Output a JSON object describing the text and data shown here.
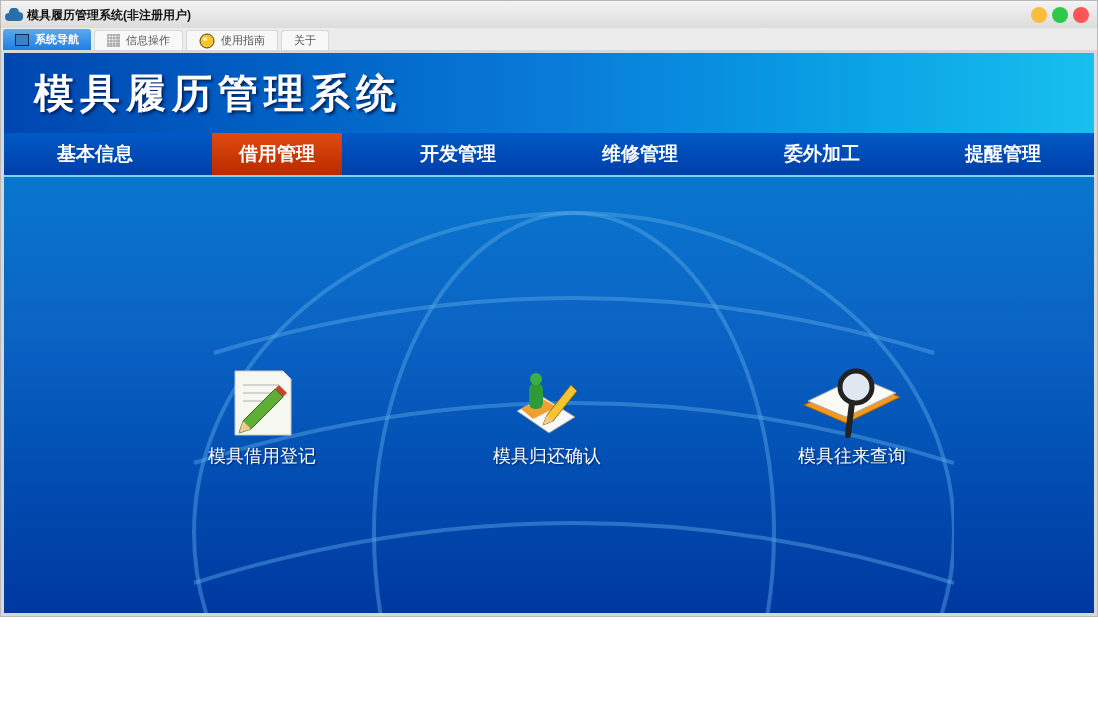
{
  "window": {
    "title": "模具履历管理系统(非注册用户)"
  },
  "tabs": [
    {
      "label": "系统导航",
      "selected": true
    },
    {
      "label": "信息操作",
      "selected": false
    },
    {
      "label": "使用指南",
      "selected": false
    },
    {
      "label": "关于",
      "selected": false
    }
  ],
  "banner": {
    "title": "模具履历管理系统"
  },
  "nav": [
    {
      "label": "基本信息",
      "selected": false
    },
    {
      "label": "借用管理",
      "selected": true
    },
    {
      "label": "开发管理",
      "selected": false
    },
    {
      "label": "维修管理",
      "selected": false
    },
    {
      "label": "委外加工",
      "selected": false
    },
    {
      "label": "提醒管理",
      "selected": false
    }
  ],
  "actions": [
    {
      "kind": "register",
      "label": "模具借用登记"
    },
    {
      "kind": "return",
      "label": "模具归还确认"
    },
    {
      "kind": "query",
      "label": "模具往来查询"
    }
  ]
}
